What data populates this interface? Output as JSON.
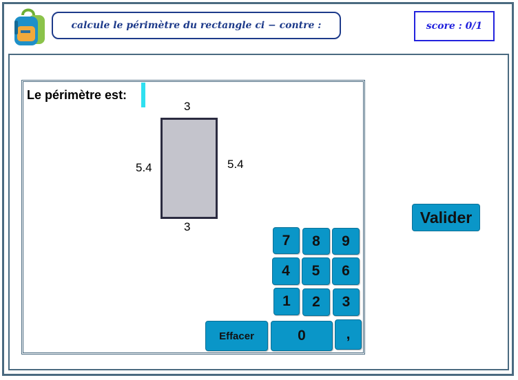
{
  "header": {
    "instruction": "calcule le périmètre du rectangle ci − contre :",
    "score": "score : 0/1"
  },
  "exercise": {
    "prompt_label": "Le périmètre est:",
    "answer_value": "",
    "rectangle": {
      "top_length": "3",
      "bottom_length": "3",
      "left_width": "5.4",
      "right_width": "5.4"
    }
  },
  "keypad": {
    "keys": [
      "7",
      "8",
      "9",
      "4",
      "5",
      "6",
      "1",
      "2",
      "3"
    ],
    "zero": "0",
    "comma": ",",
    "clear": "Effacer"
  },
  "actions": {
    "validate": "Valider"
  },
  "colors": {
    "button": "#0a96c8",
    "frame": "#4a6a80",
    "instruction_text": "#1d3a8a",
    "score_text": "#2222dd",
    "cursor": "#2fe0f0",
    "rectangle_fill": "#c4c4cc"
  }
}
